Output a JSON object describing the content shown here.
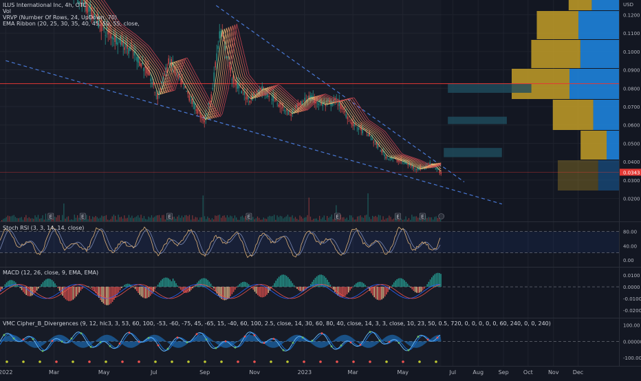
{
  "chart_data": {
    "type": "line",
    "legend": {
      "symbol_line": "ILUS International Inc, 4h, OTC",
      "vol": "Vol",
      "vrvp": "VRVP (Number Of Rows, 24, UpDown, 70)",
      "ema": "EMA Ribbon (20, 25, 30, 35, 40, 45, 50, 55, close,"
    },
    "currency": "USD",
    "current_price_label": "0.0343",
    "current_price": 0.0343,
    "price_ticks": [
      "0.1200",
      "0.1100",
      "0.1000",
      "0.0900",
      "0.0800",
      "0.0700",
      "0.0600",
      "0.0500",
      "0.0400",
      "0.0300",
      "0.0200"
    ],
    "price_tick_values": [
      0.12,
      0.11,
      0.1,
      0.09,
      0.08,
      0.07,
      0.06,
      0.05,
      0.04,
      0.03,
      0.02
    ],
    "price_range": [
      0.012,
      0.125
    ],
    "x_labels": [
      "2022",
      "Mar",
      "May",
      "Jul",
      "Sep",
      "Nov",
      "2023",
      "Mar",
      "May",
      "Jul",
      "Aug",
      "Sep",
      "Oct",
      "Nov",
      "Dec"
    ],
    "price_series": [
      [
        "2022-03-20",
        0.135
      ],
      [
        "2022-04-10",
        0.125
      ],
      [
        "2022-05-01",
        0.112
      ],
      [
        "2022-05-20",
        0.106
      ],
      [
        "2022-06-05",
        0.1
      ],
      [
        "2022-06-25",
        0.088
      ],
      [
        "2022-07-05",
        0.075
      ],
      [
        "2022-07-20",
        0.095
      ],
      [
        "2022-08-05",
        0.082
      ],
      [
        "2022-08-20",
        0.07
      ],
      [
        "2022-09-01",
        0.062
      ],
      [
        "2022-09-10",
        0.078
      ],
      [
        "2022-09-20",
        0.112
      ],
      [
        "2022-10-05",
        0.085
      ],
      [
        "2022-10-25",
        0.074
      ],
      [
        "2022-11-10",
        0.08
      ],
      [
        "2022-11-25",
        0.074
      ],
      [
        "2022-12-15",
        0.066
      ],
      [
        "2023-01-05",
        0.075
      ],
      [
        "2023-01-25",
        0.071
      ],
      [
        "2023-02-10",
        0.073
      ],
      [
        "2023-02-28",
        0.061
      ],
      [
        "2023-03-20",
        0.055
      ],
      [
        "2023-04-10",
        0.043
      ],
      [
        "2023-05-01",
        0.04
      ],
      [
        "2023-05-20",
        0.036
      ],
      [
        "2023-06-05",
        0.039
      ],
      [
        "2023-06-15",
        0.0343
      ]
    ],
    "horizontal_line_price": 0.0825,
    "trendlines": [
      {
        "from": [
          "2022-01-01",
          0.095
        ],
        "to": [
          "2023-08-30",
          0.017
        ]
      },
      {
        "from": [
          "2022-09-15",
          0.125
        ],
        "to": [
          "2023-07-15",
          0.029
        ]
      }
    ],
    "volume_profile": [
      {
        "price": 0.125,
        "up": 0.4,
        "down": 0.55
      },
      {
        "price": 0.11,
        "up": 0.72,
        "down": 0.82
      },
      {
        "price": 0.0975,
        "up": 0.85,
        "down": 0.78
      },
      {
        "price": 0.085,
        "up": 1.0,
        "down": 1.0
      },
      {
        "price": 0.0675,
        "up": 0.7,
        "down": 0.52
      },
      {
        "price": 0.0525,
        "up": 0.45,
        "down": 0.25
      },
      {
        "price": 0.0335,
        "up": 0.7,
        "down": 0.42
      }
    ],
    "zones": [
      {
        "from": "2023-06-25",
        "to": "2023-10-05",
        "low": 0.0775,
        "high": 0.0825
      },
      {
        "from": "2023-06-25",
        "to": "2023-09-05",
        "low": 0.0605,
        "high": 0.0645
      },
      {
        "from": "2023-06-20",
        "to": "2023-08-30",
        "low": 0.0425,
        "high": 0.0475
      }
    ],
    "earnings_markers": [
      "E",
      "E",
      "E",
      "E",
      "E",
      "E",
      "E"
    ],
    "panes": [
      {
        "name": "stoch",
        "label": "Stoch RSI (3, 3, 14, 14, close)",
        "ticks": [
          "80.00",
          "40.00",
          "0.00"
        ],
        "tick_values": [
          80,
          40,
          0
        ],
        "range": [
          -8,
          95
        ]
      },
      {
        "name": "macd",
        "label": "MACD (12, 26, close, 9, EMA, EMA)",
        "ticks": [
          "0.0100",
          "0.0000",
          "-0.0100",
          "-0.0200"
        ],
        "tick_values": [
          0.01,
          0,
          -0.01,
          -0.02
        ],
        "range": [
          -0.023,
          0.013
        ]
      },
      {
        "name": "vmc",
        "label": "VMC Cipher_B_Divergences (9, 12, hlc3, 3, 53, 60, 100, -53, -60, -75, 45, -65, 15, -40, 60, 100, 2.5, close, 14, 30, 60, 80, 40, close, 14, 3, 3, close, 10, 23, 50, 0.5, 720, 0, 0, 0, 0, 0, 60, 240, 0, 0, 240)",
        "ticks": [
          "100.00",
          "0.000000",
          "-100.00"
        ],
        "tick_values": [
          100,
          0,
          -100
        ],
        "range": [
          -125,
          115
        ]
      }
    ],
    "x_domain": [
      "2021-12-25",
      "2024-01-20"
    ]
  },
  "colors": {
    "background": "#131722",
    "grid": "#1e222d",
    "text": "#b2b5be",
    "price_up": "#26a69a",
    "price_down": "#ef5350",
    "ema": "#e6a96b",
    "red_line": "#e53935",
    "trendline": "#4a7ad8",
    "vp_up": "#c9a227",
    "vp_down": "#1e88e5",
    "zone": "#1f4e5f",
    "label_red": "#e53935",
    "stoch_k": "#e0b37b",
    "stoch_d": "#7b8ab8"
  }
}
